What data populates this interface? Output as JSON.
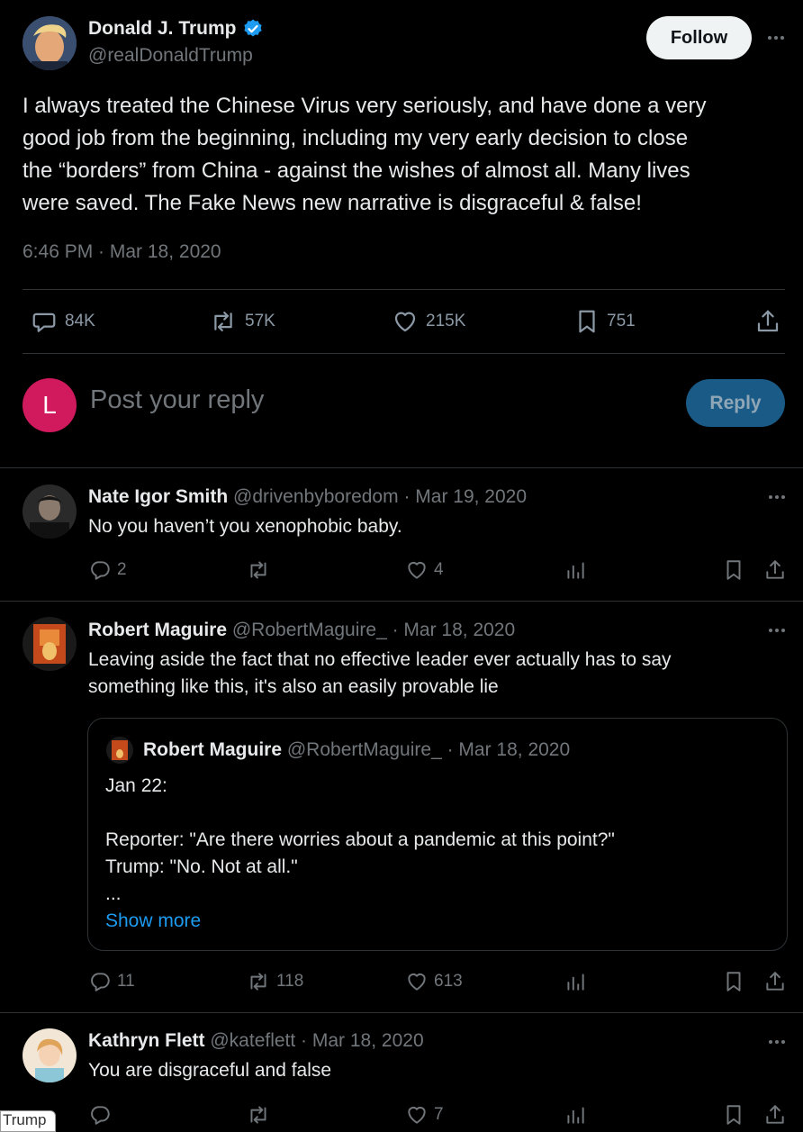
{
  "main_post": {
    "author_name": "Donald J. Trump",
    "author_handle": "@realDonaldTrump",
    "follow_label": "Follow",
    "text_lines": [
      "I always treated the Chinese Virus very seriously, and have done a very",
      "good job from the beginning, including my very early decision to close",
      "the “borders” from China - against the wishes of almost all. Many lives",
      "were saved. The Fake News new narrative is disgraceful & false!"
    ],
    "timestamp": "6:46 PM · Mar 18, 2020",
    "stats": {
      "replies": "84K",
      "reposts": "57K",
      "likes": "215K",
      "bookmarks": "751"
    }
  },
  "composer": {
    "avatar_letter": "L",
    "placeholder": "Post your reply",
    "reply_label": "Reply"
  },
  "replies": [
    {
      "author_name": "Nate Igor Smith",
      "author_meta": "@drivenbyboredom · Mar 19, 2020",
      "text_lines": [
        "No you haven’t you xenophobic baby."
      ],
      "replies": "2",
      "reposts": "",
      "likes": "4"
    },
    {
      "author_name": "Robert Maguire",
      "author_meta": "@RobertMaguire_ · Mar 18, 2020",
      "text_lines": [
        "Leaving aside the fact that no effective leader ever actually has to say",
        "something like this, it's also an easily provable lie"
      ],
      "quote": {
        "author_name": "Robert Maguire",
        "author_meta": "@RobertMaguire_ · Mar 18, 2020",
        "line1": "Jan 22:",
        "line2": "Reporter: \"Are there worries about a pandemic at this point?\"",
        "line3": "Trump: \"No. Not at all.\"",
        "line4": "...",
        "show_more": "Show more"
      },
      "replies": "11",
      "reposts": "118",
      "likes": "613"
    },
    {
      "author_name": "Kathryn Flett",
      "author_meta": "@kateflett · Mar 18, 2020",
      "text_lines": [
        "You are disgraceful and false"
      ],
      "replies": "",
      "reposts": "",
      "likes": "7"
    }
  ],
  "hover_tooltip": "Trump",
  "colors": {
    "background": "#000000",
    "text": "#e7e9ea",
    "muted": "#71767b",
    "divider": "#2f3336",
    "verified_blue": "#1d9bf0",
    "reply_button_bg": "#1a5a87",
    "avatar_pink": "#d11a5e"
  }
}
